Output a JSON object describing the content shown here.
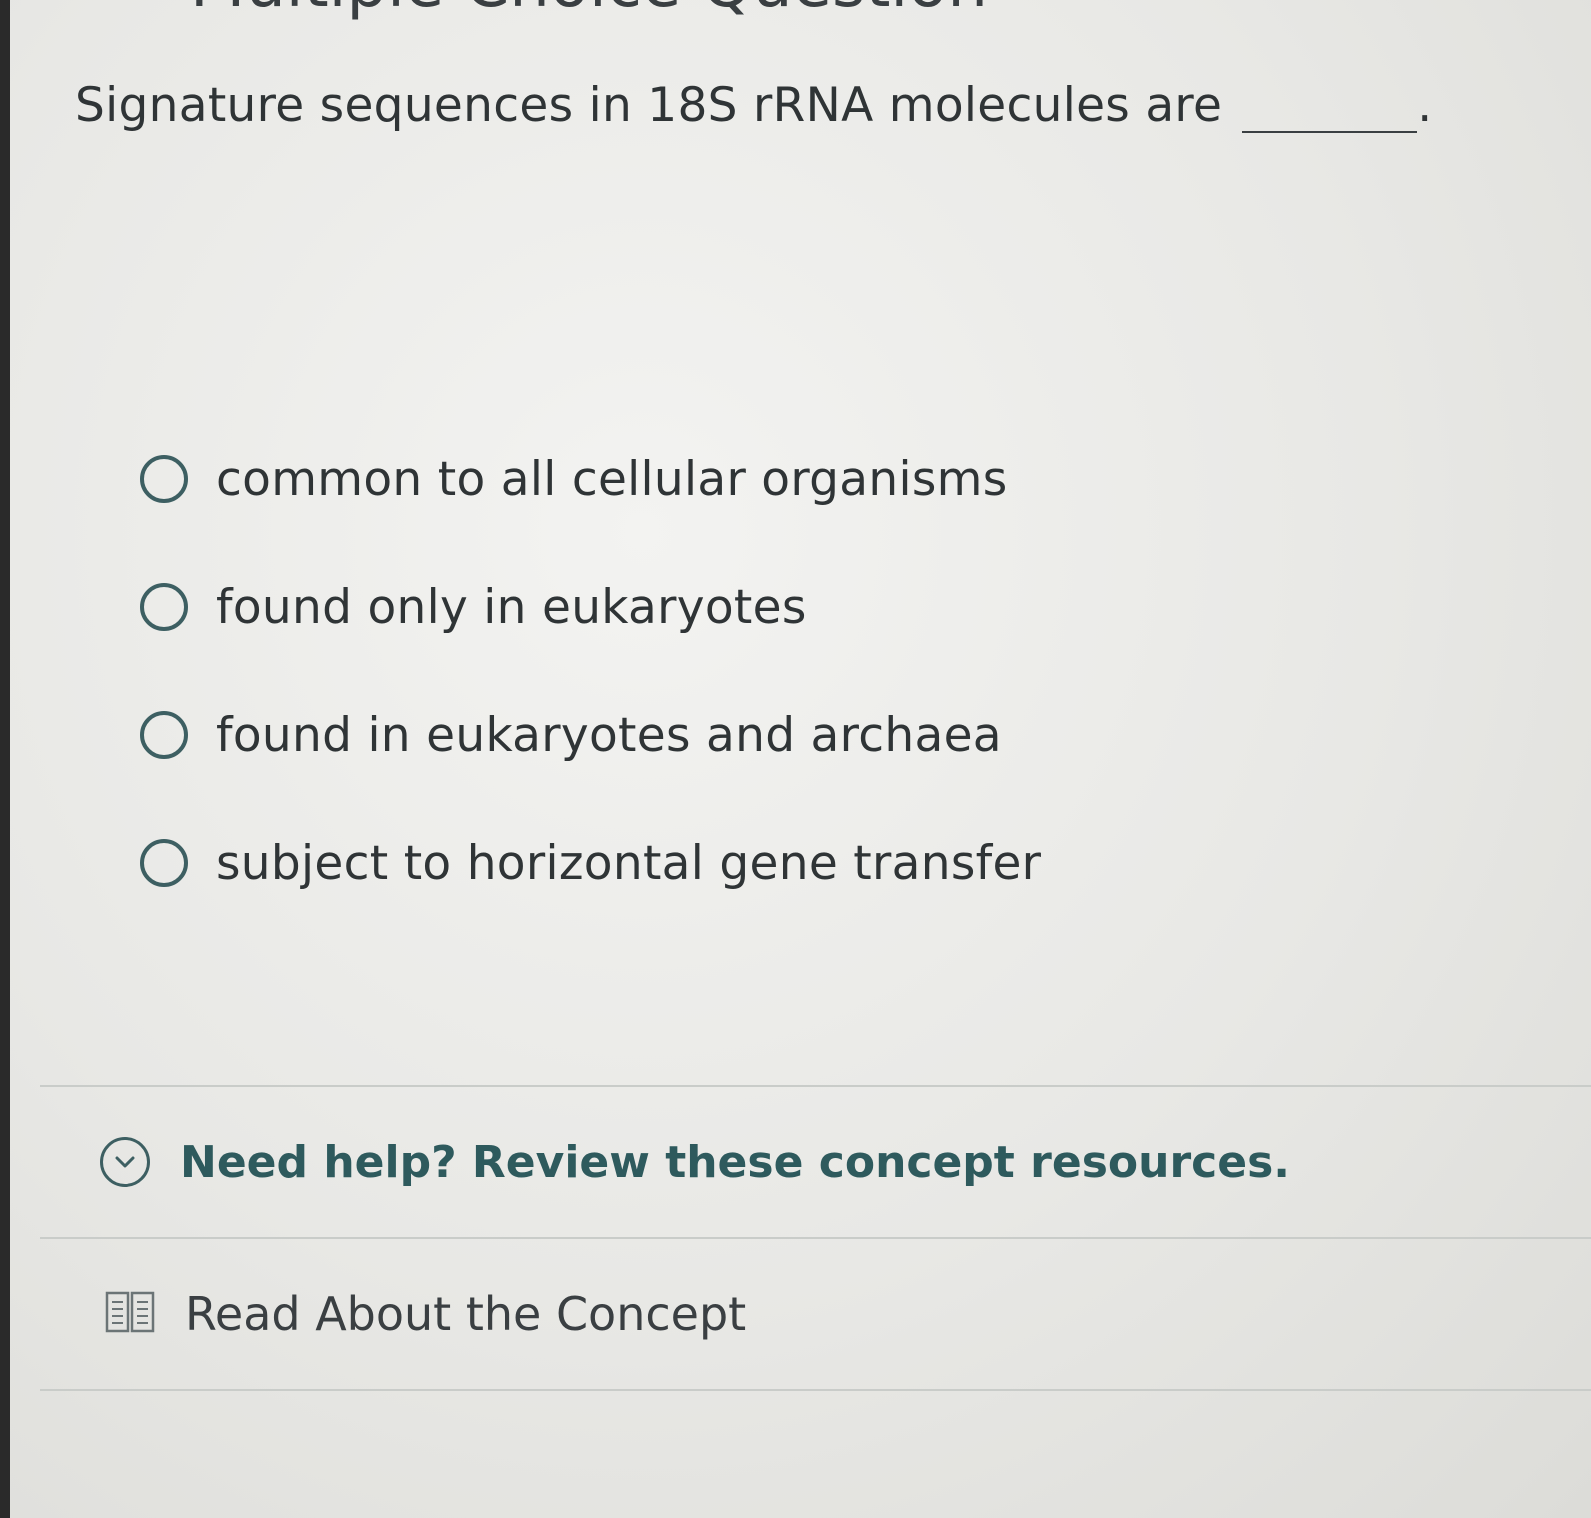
{
  "header": {
    "title_fragment": "Multiple Choice Question"
  },
  "question": {
    "text": "Signature sequences in 18S rRNA molecules are",
    "suffix": "."
  },
  "options": [
    {
      "label": "common to all cellular organisms",
      "selected": false
    },
    {
      "label": "found only in eukaryotes",
      "selected": false
    },
    {
      "label": "found in eukaryotes and archaea",
      "selected": false
    },
    {
      "label": "subject to horizontal gene transfer",
      "selected": false
    }
  ],
  "help": {
    "title": "Need help? Review these concept resources.",
    "expanded": true,
    "icon": "chevron-down-icon",
    "resources": [
      {
        "label": "Read About the Concept",
        "icon": "book-icon"
      }
    ]
  },
  "colors": {
    "accent": "#2e5a5d",
    "radio_border": "#3d5f62",
    "text": "#2f3436",
    "divider": "#c9ccc9"
  }
}
